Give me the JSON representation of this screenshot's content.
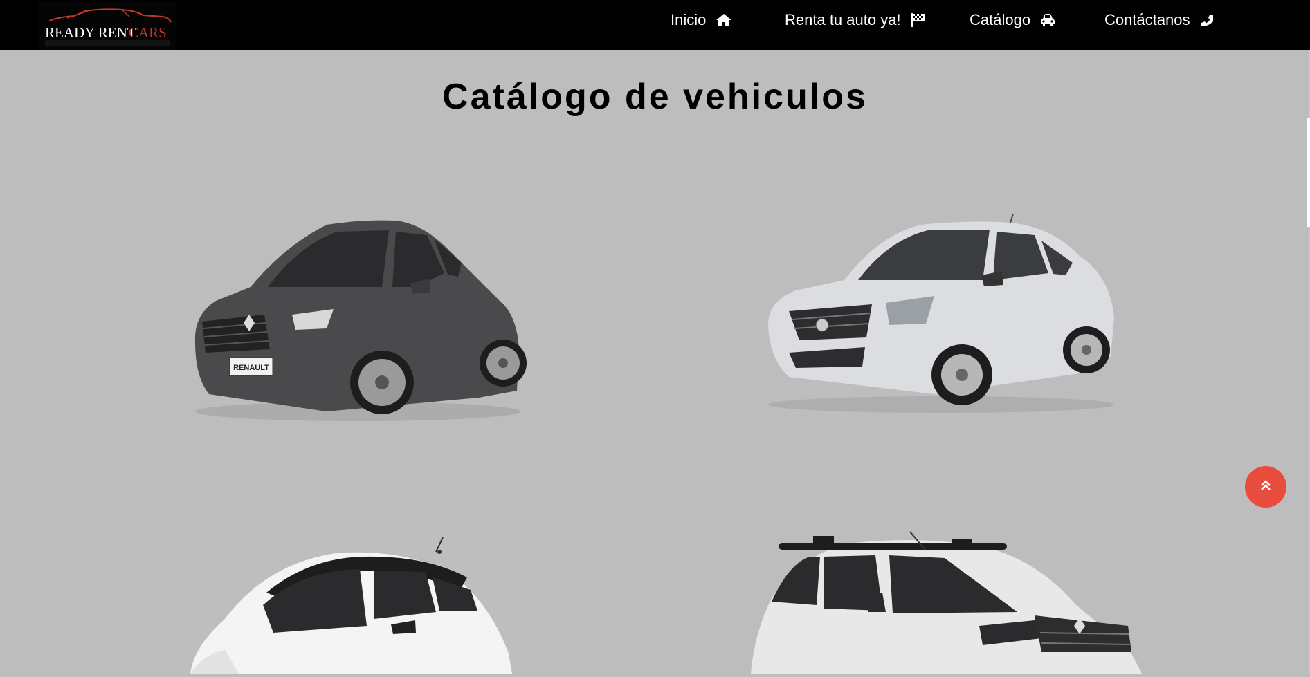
{
  "brand": {
    "logo_text_primary": "READY RENT",
    "logo_text_accent": "CARS",
    "accent_color": "#c0392b"
  },
  "nav": {
    "items": [
      {
        "label": "Inicio",
        "icon": "home-icon"
      },
      {
        "label": "Renta tu auto ya!",
        "icon": "checkered-flag-icon"
      },
      {
        "label": "Catálogo",
        "icon": "car-icon"
      },
      {
        "label": "Contáctanos",
        "icon": "phone-icon"
      }
    ]
  },
  "main": {
    "title": "Catálogo de vehiculos",
    "cars": [
      {
        "color": "#4a4a4c",
        "badge": "RENAULT"
      },
      {
        "color": "#dcdde0"
      },
      {
        "color": "#f4f4f4"
      },
      {
        "color": "#e8e8e8"
      }
    ]
  },
  "back_to_top": {
    "icon": "double-chevron-up-icon",
    "color": "#e74c3c"
  }
}
